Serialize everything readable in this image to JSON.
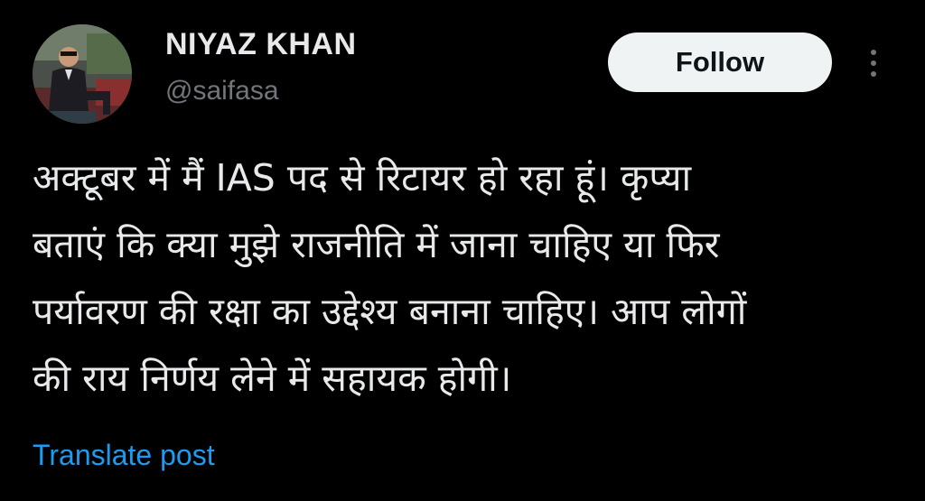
{
  "author": {
    "display_name": "NIYAZ KHAN",
    "handle": "@saifasa"
  },
  "actions": {
    "follow_label": "Follow",
    "more_icon": "more-vertical-icon"
  },
  "post": {
    "text": "अक्टूबर में मैं IAS पद से रिटायर हो रहा हूं। कृप्या\nबताएं कि क्या मुझे राजनीति में जाना चाहिए या फिर\nपर्यावरण की रक्षा का उद्देश्य बनाना चाहिए। आप लोगों\nकी राय निर्णय लेने में सहायक होगी।",
    "translate_label": "Translate post"
  },
  "colors": {
    "background": "#000000",
    "primary_text": "#e7e9ea",
    "secondary_text": "#71767b",
    "link": "#1d9bf0",
    "button_bg": "#eff3f4"
  }
}
